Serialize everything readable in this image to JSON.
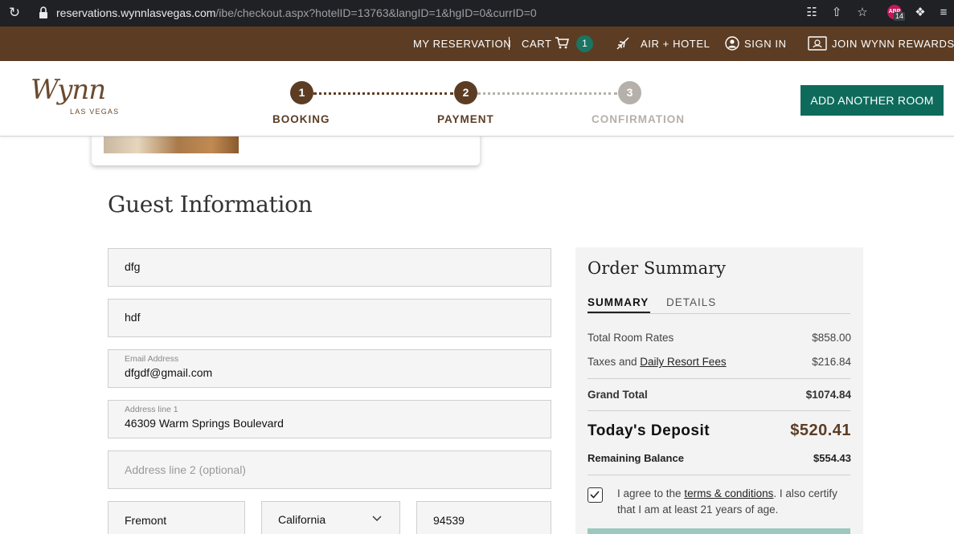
{
  "browser": {
    "url_host": "reservations.wynnlasvegas.com",
    "url_path": "/ibe/checkout.aspx?hotelID=13763&langID=1&hgID=0&currID=0",
    "extension_badge": "14",
    "extension_label": "ABP"
  },
  "topnav": {
    "my_reservation": "MY RESERVATION",
    "separator": "|",
    "cart": "CART",
    "cart_count": "1",
    "air_hotel": "AIR + HOTEL",
    "sign_in": "SIGN IN",
    "join_rewards": "JOIN WYNN REWARDS"
  },
  "header": {
    "logo_script": "Wynn",
    "logo_sub": "LAS VEGAS",
    "steps": [
      {
        "number": "1",
        "label": "BOOKING",
        "state": "complete"
      },
      {
        "number": "2",
        "label": "PAYMENT",
        "state": "active"
      },
      {
        "number": "3",
        "label": "CONFIRMATION",
        "state": "pending"
      }
    ],
    "add_room": "ADD ANOTHER ROOM"
  },
  "colors": {
    "brown": "#5c3d24",
    "teal": "#0e6b5c",
    "step_inactive": "#b5b0aa",
    "deposit": "#5c3d24"
  },
  "guest": {
    "title": "Guest Information",
    "first_name": "dfg",
    "last_name": "hdf",
    "email_label": "Email Address",
    "email": "dfgdf@gmail.com",
    "address1_label": "Address line 1",
    "address1": "46309 Warm Springs Boulevard",
    "address2_placeholder": "Address line 2 (optional)",
    "city": "Fremont",
    "state": "California",
    "zip": "94539"
  },
  "summary": {
    "title": "Order Summary",
    "tab_summary": "SUMMARY",
    "tab_details": "DETAILS",
    "room_rates_label": "Total Room Rates",
    "room_rates_value": "$858.00",
    "taxes_label": "Taxes and ",
    "taxes_link": "Daily Resort Fees",
    "taxes_value": "$216.84",
    "grand_total_label": "Grand Total",
    "grand_total_value": "$1074.84",
    "deposit_label": "Today's Deposit",
    "deposit_value": "$520.41",
    "remaining_label": "Remaining Balance",
    "remaining_value": "$554.43",
    "agree_pre": "I agree to the ",
    "agree_link": "terms & conditions",
    "agree_post": ". I also certify that I am at least 21 years of age."
  }
}
